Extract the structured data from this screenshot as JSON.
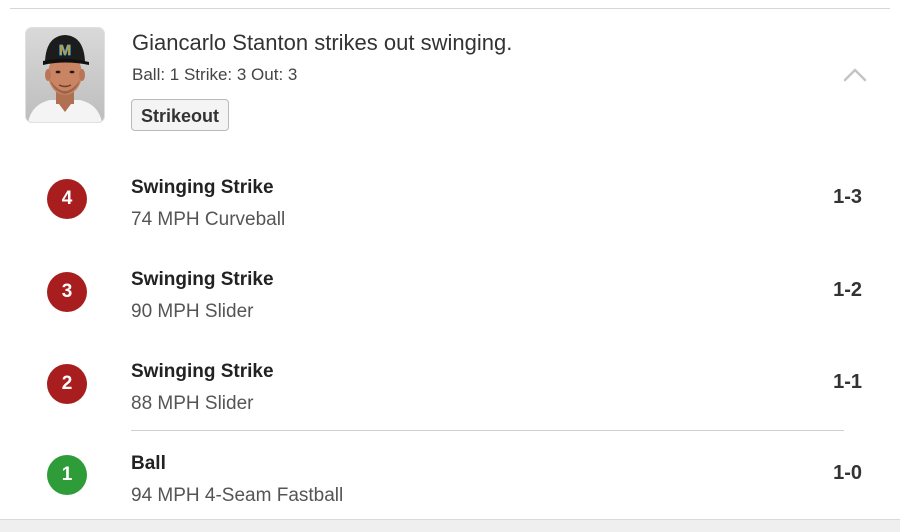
{
  "play": {
    "headline": "Giancarlo Stanton strikes out swinging.",
    "count_line": "Ball: 1 Strike: 3 Out: 3",
    "badge": "Strikeout",
    "player_avatar_icon": "player-headshot",
    "collapse_icon": "chevron-up-icon"
  },
  "colors": {
    "strike": "#a81e1e",
    "ball": "#2e9c39"
  },
  "pitches": [
    {
      "number": "4",
      "result": "Swinging Strike",
      "description": "74 MPH Curveball",
      "count": "1-3",
      "type": "strike"
    },
    {
      "number": "3",
      "result": "Swinging Strike",
      "description": "90 MPH Slider",
      "count": "1-2",
      "type": "strike"
    },
    {
      "number": "2",
      "result": "Swinging Strike",
      "description": "88 MPH Slider",
      "count": "1-1",
      "type": "strike"
    },
    {
      "number": "1",
      "result": "Ball",
      "description": "94 MPH 4-Seam Fastball",
      "count": "1-0",
      "type": "ball"
    }
  ]
}
